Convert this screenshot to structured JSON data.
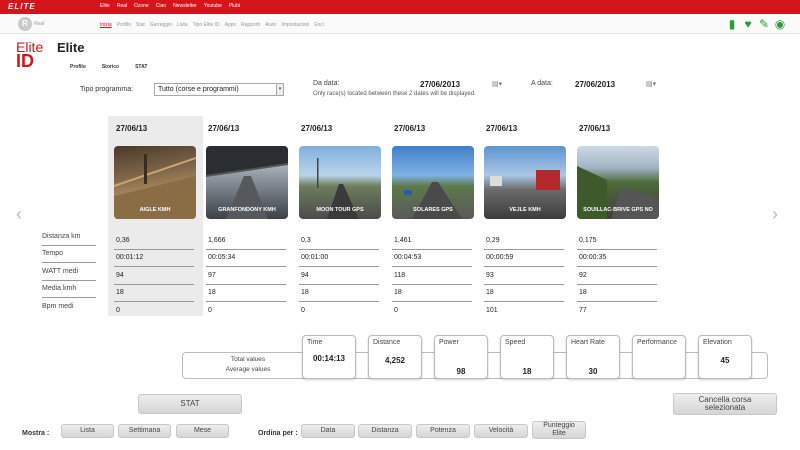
{
  "topbar": {
    "logo": "ELITE",
    "menu": [
      "Elite",
      "Real",
      "Ozone",
      "Ciao",
      "Newsletter",
      "Youtube",
      "Plubi"
    ]
  },
  "navbar": {
    "logo_letter": "R",
    "logo_text": "Real",
    "menu": [
      "Inizia",
      "Profilo",
      "Stat",
      "Garreggio",
      "Lista",
      "Tipo Elite ID",
      "Apps",
      "Rapporti",
      "Aiuto",
      "Impostazioni",
      "Esci"
    ],
    "icons": [
      "battery-icon",
      "heart-icon",
      "wrench-icon",
      "globe-icon"
    ]
  },
  "brand": {
    "line1": "Elite",
    "line2": "ID"
  },
  "page_title": "Elite",
  "subtabs": [
    "Profilo",
    "Storico",
    "STAT"
  ],
  "filters": {
    "tipo_label": "Tipo programma:",
    "tipo_value": "Tutto (corse e programmi)",
    "da_label": "Da data:",
    "da_value": "27/06/2013",
    "a_label": "A data:",
    "a_value": "27/06/2013",
    "note": "Only race(s) located between these 2 dates will be displayed."
  },
  "row_labels": [
    "Distanza km",
    "Tempo",
    "WATT medi",
    "Media kmh",
    "Bpm medi"
  ],
  "columns": [
    {
      "date": "27/06/13",
      "name": "AIGLE KMH",
      "stats": [
        "0,36",
        "00:01:12",
        "94",
        "18",
        "0"
      ]
    },
    {
      "date": "27/06/13",
      "name": "GRANFONDONY KMH",
      "stats": [
        "1,666",
        "00:05:34",
        "97",
        "18",
        "0"
      ]
    },
    {
      "date": "27/06/13",
      "name": "MOON TOUR GPS",
      "stats": [
        "0,3",
        "00:01:00",
        "94",
        "18",
        "0"
      ]
    },
    {
      "date": "27/06/13",
      "name": "SOLARES GPS",
      "stats": [
        "1,461",
        "00:04:53",
        "118",
        "18",
        "0"
      ]
    },
    {
      "date": "27/06/13",
      "name": "VEJLE KMH",
      "stats": [
        "0,29",
        "00:00:59",
        "93",
        "18",
        "101"
      ]
    },
    {
      "date": "27/06/13",
      "name": "SOUILLAC-BRIVE GPS NO",
      "stats": [
        "0,175",
        "00:00:35",
        "92",
        "18",
        "77"
      ]
    }
  ],
  "totals": {
    "total_label": "Total values",
    "average_label": "Average values",
    "metrics": [
      {
        "label": "Time",
        "total": "00:14:13",
        "average": ""
      },
      {
        "label": "Distance",
        "total": "4,252",
        "average": ""
      },
      {
        "label": "Power",
        "total": "",
        "average": "98"
      },
      {
        "label": "Speed",
        "total": "",
        "average": "18"
      },
      {
        "label": "Heart Rate",
        "total": "",
        "average": "30"
      },
      {
        "label": "Performance",
        "total": "",
        "average": ""
      },
      {
        "label": "Elevation",
        "total": "45",
        "average": ""
      }
    ]
  },
  "actions": {
    "stat": "STAT",
    "cancel_line1": "Cancella corsa",
    "cancel_line2": "selezionata"
  },
  "bottom": {
    "mostra_label": "Mostra :",
    "mostra": [
      "Lista",
      "Settimana",
      "Mese"
    ],
    "ordina_label": "Ordina per :",
    "ordina": [
      "Data",
      "Distanza",
      "Potenza",
      "Velocità"
    ],
    "punteggio_line1": "Punteggio",
    "punteggio_line2": "Elite"
  }
}
